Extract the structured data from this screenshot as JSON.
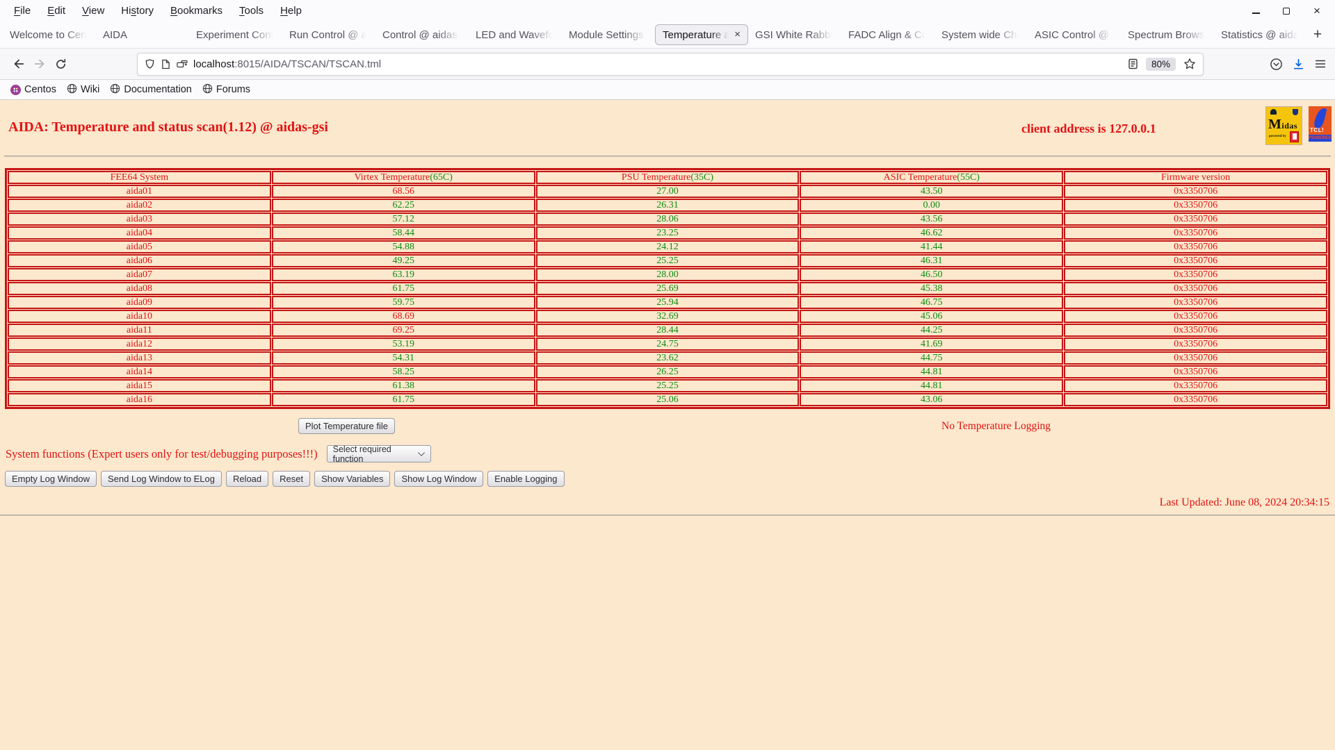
{
  "window": {
    "menu": [
      {
        "label": "File",
        "accel": 0
      },
      {
        "label": "Edit",
        "accel": 0
      },
      {
        "label": "View",
        "accel": 0
      },
      {
        "label": "History",
        "accel": 2
      },
      {
        "label": "Bookmarks",
        "accel": 0
      },
      {
        "label": "Tools",
        "accel": 0
      },
      {
        "label": "Help",
        "accel": 0
      }
    ]
  },
  "tabs": {
    "items": [
      {
        "label": "Welcome to Cent",
        "active": false
      },
      {
        "label": "AIDA",
        "active": false
      },
      {
        "label": "Experiment Contr",
        "active": false
      },
      {
        "label": "Run Control @ ai",
        "active": false
      },
      {
        "label": "Control @ aidas-",
        "active": false
      },
      {
        "label": "LED and Wavefor",
        "active": false
      },
      {
        "label": "Module Settings",
        "active": false
      },
      {
        "label": "Temperature an",
        "active": true
      },
      {
        "label": "GSI White Rabbit",
        "active": false
      },
      {
        "label": "FADC Align & Co",
        "active": false
      },
      {
        "label": "System wide Che",
        "active": false
      },
      {
        "label": "ASIC Control @ a",
        "active": false
      },
      {
        "label": "Spectrum Browse",
        "active": false
      },
      {
        "label": "Statistics @ aidas",
        "active": false
      }
    ],
    "new_tab": "+"
  },
  "navbar": {
    "url_host": "localhost",
    "url_path": ":8015/AIDA/TSCAN/TSCAN.tml",
    "zoom": "80%"
  },
  "bookmarks": [
    {
      "label": "Centos",
      "icon": "centos-logo"
    },
    {
      "label": "Wiki",
      "icon": "globe"
    },
    {
      "label": "Documentation",
      "icon": "globe"
    },
    {
      "label": "Forums",
      "icon": "globe"
    }
  ],
  "page": {
    "title": "AIDA: Temperature and status scan(1.12) @ aidas-gsi",
    "client_address": "client address is 127.0.0.1",
    "logos": {
      "midas_text": "idas",
      "midas_initial": "M",
      "midas_sub": "powered by",
      "tcl_line1": "TCL!",
      "tcl_line2": "POWERED"
    },
    "table": {
      "columns": [
        {
          "key": "system",
          "label": "FEE64 System",
          "limit": ""
        },
        {
          "key": "virtex",
          "label": "Virtex Temperature",
          "limit": "(65C)",
          "threshold": 65
        },
        {
          "key": "psu",
          "label": "PSU Temperature",
          "limit": "(35C)",
          "threshold": 35
        },
        {
          "key": "asic",
          "label": "ASIC Temperature",
          "limit": "(55C)",
          "threshold": 55
        },
        {
          "key": "firmware",
          "label": "Firmware version",
          "limit": ""
        }
      ],
      "rows": [
        {
          "system": "aida01",
          "virtex": "68.56",
          "psu": "27.00",
          "asic": "43.50",
          "firmware": "0x3350706"
        },
        {
          "system": "aida02",
          "virtex": "62.25",
          "psu": "26.31",
          "asic": "0.00",
          "firmware": "0x3350706"
        },
        {
          "system": "aida03",
          "virtex": "57.12",
          "psu": "28.06",
          "asic": "43.56",
          "firmware": "0x3350706"
        },
        {
          "system": "aida04",
          "virtex": "58.44",
          "psu": "23.25",
          "asic": "46.62",
          "firmware": "0x3350706"
        },
        {
          "system": "aida05",
          "virtex": "54.88",
          "psu": "24.12",
          "asic": "41.44",
          "firmware": "0x3350706"
        },
        {
          "system": "aida06",
          "virtex": "49.25",
          "psu": "25.25",
          "asic": "46.31",
          "firmware": "0x3350706"
        },
        {
          "system": "aida07",
          "virtex": "63.19",
          "psu": "28.00",
          "asic": "46.50",
          "firmware": "0x3350706"
        },
        {
          "system": "aida08",
          "virtex": "61.75",
          "psu": "25.69",
          "asic": "45.38",
          "firmware": "0x3350706"
        },
        {
          "system": "aida09",
          "virtex": "59.75",
          "psu": "25.94",
          "asic": "46.75",
          "firmware": "0x3350706"
        },
        {
          "system": "aida10",
          "virtex": "68.69",
          "psu": "32.69",
          "asic": "45.06",
          "firmware": "0x3350706"
        },
        {
          "system": "aida11",
          "virtex": "69.25",
          "psu": "28.44",
          "asic": "44.25",
          "firmware": "0x3350706"
        },
        {
          "system": "aida12",
          "virtex": "53.19",
          "psu": "24.75",
          "asic": "41.69",
          "firmware": "0x3350706"
        },
        {
          "system": "aida13",
          "virtex": "54.31",
          "psu": "23.62",
          "asic": "44.75",
          "firmware": "0x3350706"
        },
        {
          "system": "aida14",
          "virtex": "58.25",
          "psu": "26.25",
          "asic": "44.81",
          "firmware": "0x3350706"
        },
        {
          "system": "aida15",
          "virtex": "61.38",
          "psu": "25.25",
          "asic": "44.81",
          "firmware": "0x3350706"
        },
        {
          "system": "aida16",
          "virtex": "61.75",
          "psu": "25.06",
          "asic": "43.06",
          "firmware": "0x3350706"
        }
      ]
    },
    "plot_button": "Plot Temperature file",
    "logging_status": "No Temperature Logging",
    "system_functions_label": "System functions (Expert users only for test/debugging purposes!!!)",
    "function_select_value": "Select required function",
    "action_buttons": [
      "Empty Log Window",
      "Send Log Window to ELog",
      "Reload",
      "Reset",
      "Show Variables",
      "Show Log Window",
      "Enable Logging"
    ],
    "last_updated": "Last Updated: June 08, 2024 20:34:15"
  },
  "colors": {
    "page_bg": "#fbe8cd",
    "red_text": "#e31212",
    "green_text": "#0f8b12",
    "table_border": "#c61414"
  }
}
